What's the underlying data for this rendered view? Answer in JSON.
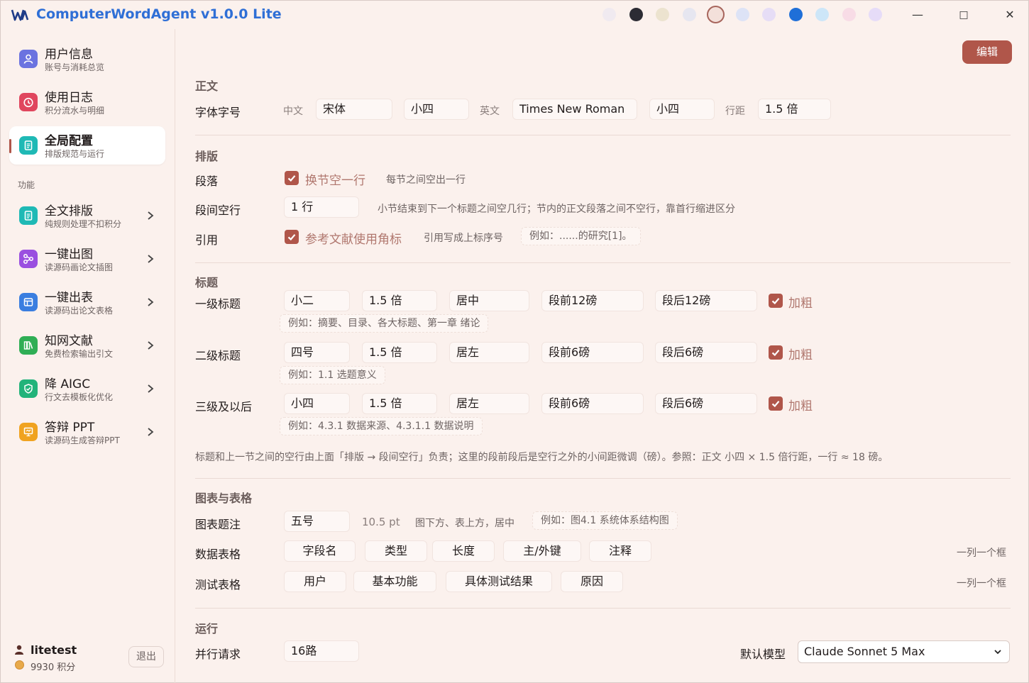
{
  "titlebar": {
    "title": "ComputerWordAgent v1.0.0 Lite",
    "theme_colors": [
      "#f0eaf0",
      "#2c2c34",
      "#ece3cf",
      "#e6e6f0",
      "#f3e0da",
      "#dde3f6",
      "#e6ddf6",
      "#1f6fd8",
      "#cde6f8",
      "#f8dce6",
      "#e6dcf8"
    ],
    "selected_theme_index": 4,
    "minimize": "—",
    "maximize": "□",
    "close": "✕"
  },
  "sidebar": {
    "items": [
      {
        "title": "用户信息",
        "sub": "账号与消耗总览",
        "icon": "user-icon",
        "color": "#6b73e0"
      },
      {
        "title": "使用日志",
        "sub": "积分流水与明细",
        "icon": "clock-icon",
        "color": "#e0465e"
      },
      {
        "title": "全局配置",
        "sub": "排版规范与运行",
        "icon": "document-icon",
        "color": "#1fb9b5"
      }
    ],
    "section_label": "功能",
    "features": [
      {
        "title": "全文排版",
        "sub": "纯规则处理不扣积分",
        "icon": "document-icon",
        "color": "#1fb9b5"
      },
      {
        "title": "一键出图",
        "sub": "读源码画论文插图",
        "icon": "diagram-icon",
        "color": "#9a4fe0"
      },
      {
        "title": "一键出表",
        "sub": "读源码出论文表格",
        "icon": "table-icon",
        "color": "#3a7ee0"
      },
      {
        "title": "知网文献",
        "sub": "免费检索输出引文",
        "icon": "books-icon",
        "color": "#2fae55"
      },
      {
        "title": "降 AIGC",
        "sub": "行文去模板化优化",
        "icon": "shield-icon",
        "color": "#22b37a"
      },
      {
        "title": "答辩 PPT",
        "sub": "读源码生成答辩PPT",
        "icon": "presentation-icon",
        "color": "#f0a320"
      }
    ],
    "user": {
      "name": "litetest",
      "points": "9930 积分",
      "logout": "退出"
    }
  },
  "main": {
    "edit": "编辑",
    "body": {
      "title": "正文",
      "label": "字体字号",
      "cn_label": "中文",
      "cn_font": "宋体",
      "cn_size": "小四",
      "en_label": "英文",
      "en_font": "Times New Roman",
      "en_size": "小四",
      "spacing_label": "行距",
      "spacing": "1.5 倍"
    },
    "layout": {
      "title": "排版",
      "para_label": "段落",
      "para_check": "换节空一行",
      "para_hint": "每节之间空出一行",
      "gap_label": "段间空行",
      "gap_value": "1 行",
      "gap_hint": "小节结束到下一个标题之间空几行；节内的正文段落之间不空行，靠首行缩进区分",
      "cite_label": "引用",
      "cite_check": "参考文献使用角标",
      "cite_hint": "引用写成上标序号",
      "cite_example": "例如：......的研究[1]。"
    },
    "headings": {
      "title": "标题",
      "rows": [
        {
          "label": "一级标题",
          "size": "小二",
          "spacing": "1.5 倍",
          "align": "居中",
          "before": "段前12磅",
          "after": "段后12磅",
          "bold": "加粗",
          "example": "例如：摘要、目录、各大标题、第一章 绪论"
        },
        {
          "label": "二级标题",
          "size": "四号",
          "spacing": "1.5 倍",
          "align": "居左",
          "before": "段前6磅",
          "after": "段后6磅",
          "bold": "加粗",
          "example": "例如：1.1 选题意义"
        },
        {
          "label": "三级及以后",
          "size": "小四",
          "spacing": "1.5 倍",
          "align": "居左",
          "before": "段前6磅",
          "after": "段后6磅",
          "bold": "加粗",
          "example": "例如：4.3.1 数据来源、4.3.1.1 数据说明"
        }
      ],
      "note": "标题和上一节之间的空行由上面「排版 → 段间空行」负责；这里的段前段后是空行之外的小间距微调（磅）。参照：正文 小四 × 1.5 倍行距，一行 ≈ 18 磅。"
    },
    "figures": {
      "title": "图表与表格",
      "caption_label": "图表题注",
      "caption_size": "五号",
      "caption_pt": "10.5 pt",
      "caption_hint": "图下方、表上方，居中",
      "caption_example": "例如：图4.1 系统体系结构图",
      "data_label": "数据表格",
      "data_cols": [
        "字段名",
        "类型",
        "长度",
        "主/外键",
        "注释"
      ],
      "data_hint": "一列一个框",
      "test_label": "测试表格",
      "test_cols": [
        "用户",
        "基本功能",
        "具体测试结果",
        "原因"
      ],
      "test_hint": "一列一个框"
    },
    "run": {
      "title": "运行",
      "parallel_label": "并行请求",
      "parallel_value": "16路",
      "model_label": "默认模型",
      "model_value": "Claude Sonnet 5 Max"
    }
  }
}
